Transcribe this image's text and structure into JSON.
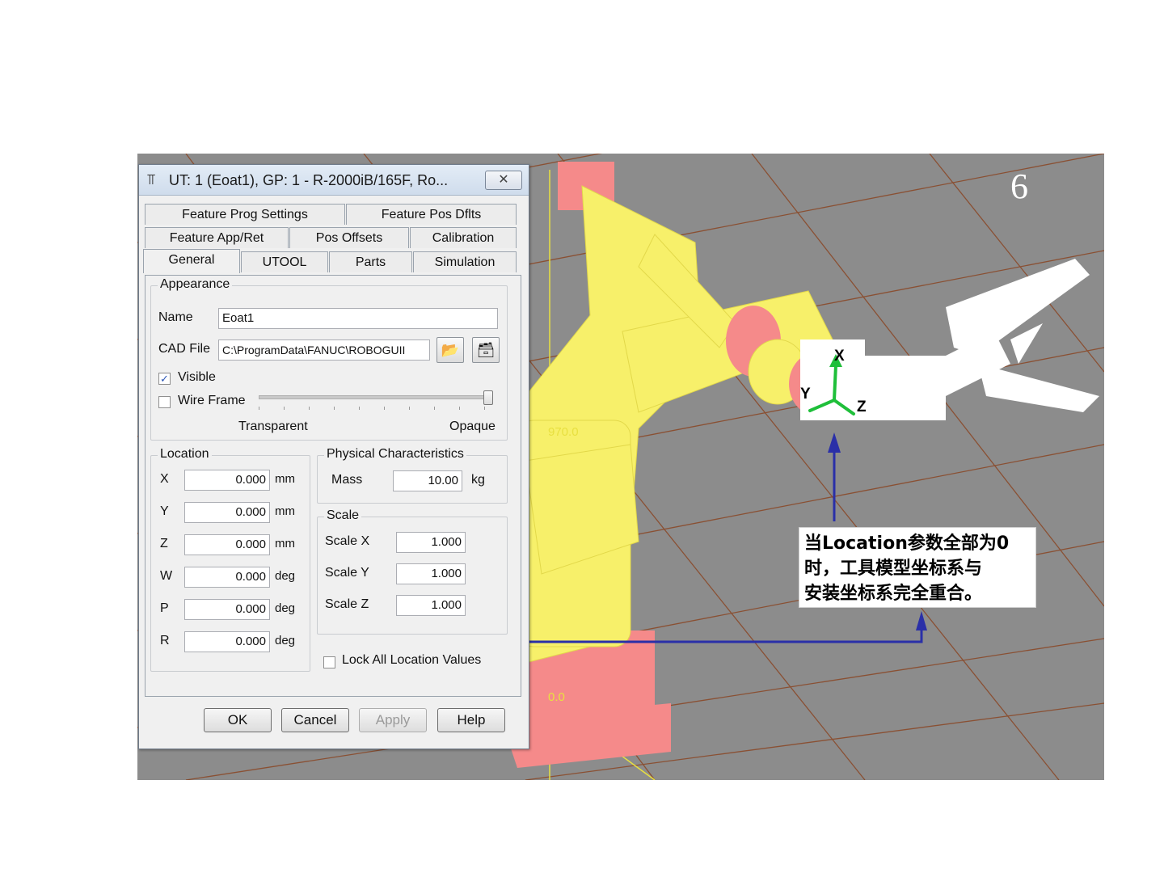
{
  "slide_number": "6",
  "dialog": {
    "title": "UT: 1  (Eoat1), GP: 1 - R-2000iB/165F, Ro...",
    "close_symbol": "✕",
    "tabs_row1": [
      "Feature Prog Settings",
      "Feature Pos Dflts"
    ],
    "tabs_row2": [
      "Feature App/Ret",
      "Pos Offsets",
      "Calibration"
    ],
    "tabs_row3": [
      "General",
      "UTOOL",
      "Parts",
      "Simulation"
    ],
    "active_tab": "General",
    "appearance": {
      "legend": "Appearance",
      "name_label": "Name",
      "name_value": "Eoat1",
      "cad_label": "CAD File",
      "cad_value": "C:\\ProgramData\\FANUC\\ROBOGUII",
      "visible_label": "Visible",
      "visible_checked": true,
      "wireframe_label": "Wire Frame",
      "wireframe_checked": false,
      "transparent_label": "Transparent",
      "opaque_label": "Opaque",
      "opacity_level": 1.0
    },
    "location": {
      "legend": "Location",
      "rows": [
        {
          "axis": "X",
          "value": "0.000",
          "unit": "mm"
        },
        {
          "axis": "Y",
          "value": "0.000",
          "unit": "mm"
        },
        {
          "axis": "Z",
          "value": "0.000",
          "unit": "mm"
        },
        {
          "axis": "W",
          "value": "0.000",
          "unit": "deg"
        },
        {
          "axis": "P",
          "value": "0.000",
          "unit": "deg"
        },
        {
          "axis": "R",
          "value": "0.000",
          "unit": "deg"
        }
      ]
    },
    "physical": {
      "legend": "Physical Characteristics",
      "mass_label": "Mass",
      "mass_value": "10.00",
      "mass_unit": "kg"
    },
    "scale": {
      "legend": "Scale",
      "rows": [
        {
          "label": "Scale X",
          "value": "1.000"
        },
        {
          "label": "Scale Y",
          "value": "1.000"
        },
        {
          "label": "Scale Z",
          "value": "1.000"
        }
      ]
    },
    "lock_label": "Lock All Location Values",
    "lock_checked": false,
    "buttons": {
      "ok": "OK",
      "cancel": "Cancel",
      "apply": "Apply",
      "help": "Help"
    }
  },
  "viewport": {
    "axis_labels": {
      "x": "X",
      "y": "Y",
      "z": "Z"
    },
    "grid_labels": [
      "970.0",
      "0.0"
    ]
  },
  "callout": {
    "lines": [
      "当Location参数全部为0",
      "时，工具模型坐标系与",
      "安装坐标系完全重合。"
    ]
  },
  "colors": {
    "scene_bg": "#8c8c8c",
    "robot_yellow": "#f7f06a",
    "robot_pink": "#f58a8a",
    "annotation_blue": "#2a2fa8",
    "grid_brown": "#8a4a2a"
  }
}
